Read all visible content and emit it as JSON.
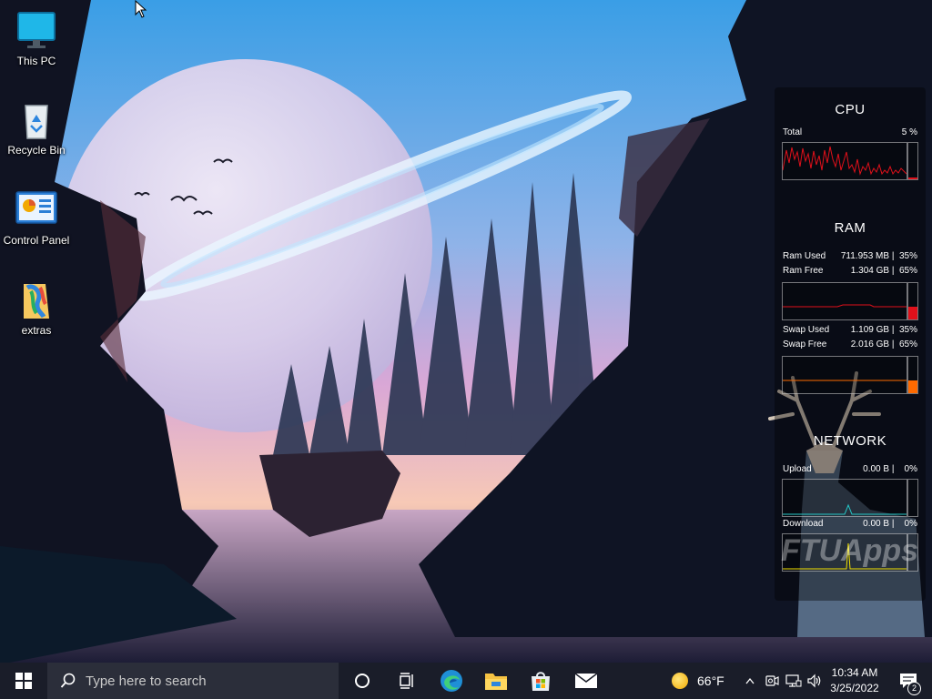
{
  "desktop": {
    "icons": [
      {
        "label": "This PC",
        "icon": "this-pc-icon"
      },
      {
        "label": "Recycle Bin",
        "icon": "recycle-bin-icon"
      },
      {
        "label": "Control Panel",
        "icon": "control-panel-icon"
      },
      {
        "label": "extras",
        "icon": "extras-folder-icon"
      }
    ],
    "watermark": "FTUApps"
  },
  "widget": {
    "cpu": {
      "title": "CPU",
      "total_label": "Total",
      "total_value": "5 %",
      "graph_color": "#e0101a",
      "level_percent": 5
    },
    "ram": {
      "title": "RAM",
      "used_label": "Ram Used",
      "used_value": "711.953 MB |  35%",
      "free_label": "Ram Free",
      "free_value": "1.304 GB |  65%",
      "swap_used_label": "Swap Used",
      "swap_used_value": "1.109 GB |  35%",
      "swap_free_label": "Swap Free",
      "swap_free_value": "2.016 GB |  65%",
      "ram_level_percent": 35,
      "swap_level_percent": 35,
      "ram_color": "#e0101a",
      "swap_color": "#ff6a00"
    },
    "network": {
      "title": "NETWORK",
      "upload_label": "Upload",
      "upload_value": "0.00 B |    0%",
      "download_label": "Download",
      "download_value": "0.00 B |    0%",
      "upload_color": "#25c9c9",
      "download_color": "#f0e000"
    }
  },
  "taskbar": {
    "search_placeholder": "Type here to search",
    "apps": [
      {
        "name": "cortana-icon"
      },
      {
        "name": "task-view-icon"
      },
      {
        "name": "edge-icon"
      },
      {
        "name": "file-explorer-icon"
      },
      {
        "name": "microsoft-store-icon"
      },
      {
        "name": "mail-icon"
      }
    ],
    "weather": {
      "temp": "66°F",
      "icon": "sun-icon"
    },
    "tray": {
      "chevron": "^",
      "icons": [
        "meet-now-icon",
        "network-icon",
        "volume-icon"
      ]
    },
    "clock": {
      "time": "10:34 AM",
      "date": "3/25/2022"
    },
    "notifications": {
      "count": "2"
    }
  }
}
